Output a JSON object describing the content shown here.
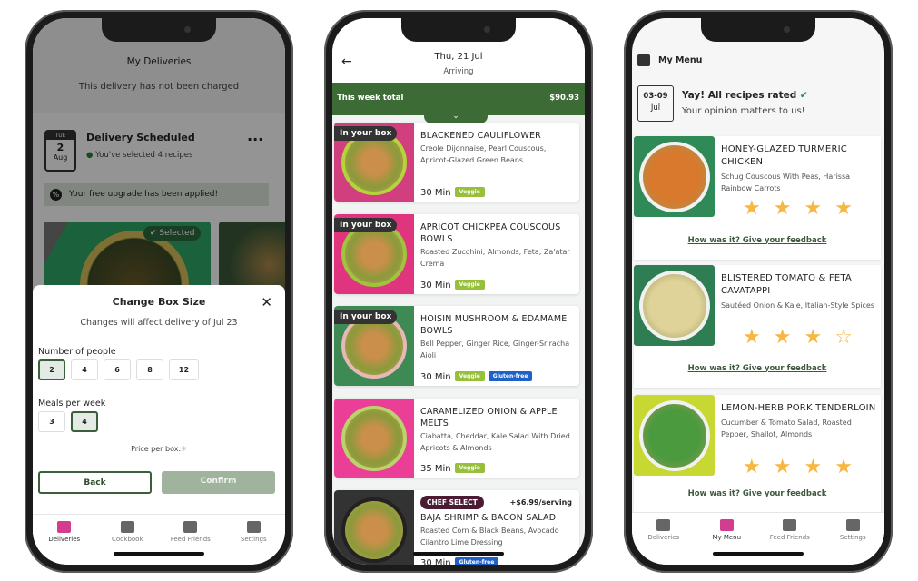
{
  "colors": {
    "brand_green": "#3d6b35",
    "accent_pink": "#d43c8e",
    "veggie": "#96bf3a",
    "gluten_free": "#1e62c9",
    "chef_select": "#4a1b33",
    "star": "#f7b843"
  },
  "deliveries": {
    "title": "My Deliveries",
    "subtitle": "This delivery has not been charged",
    "calendar": {
      "weekday": "TUE",
      "day": "2",
      "month": "Aug"
    },
    "status_title": "Delivery Scheduled",
    "status_text": "You've selected 4 recipes",
    "more_icon": "ellipsis-icon",
    "upgrade_banner": "Your free upgrade has been applied!",
    "selected_badge": "Selected",
    "modal": {
      "title": "Change Box Size",
      "subtitle": "Changes will affect delivery of  Jul 23",
      "people_label": "Number of people",
      "people_options": [
        "2",
        "4",
        "6",
        "8",
        "12"
      ],
      "people_selected": "2",
      "meals_label": "Meals per week",
      "meals_options": [
        "3",
        "4"
      ],
      "meals_selected": "4",
      "price_label": "Price per box:",
      "back": "Back",
      "confirm": "Confirm"
    },
    "nav": [
      "Deliveries",
      "Cookbook",
      "Feed Friends",
      "Settings"
    ],
    "nav_active": "Deliveries"
  },
  "week": {
    "date": "Thu, 21 Jul",
    "status": "Arriving",
    "total_label": "This week total",
    "total": "$90.93",
    "recipes": [
      {
        "badge": "In your box",
        "title": "BLACKENED CAULIFLOWER",
        "desc": "Creole Dijonnaise, Pearl Couscous, Apricot-Glazed Green Beans",
        "time": "30 Min",
        "tags": [
          "Veggie"
        ]
      },
      {
        "badge": "In your box",
        "title": "APRICOT CHICKPEA COUSCOUS BOWLS",
        "desc": "Roasted Zucchini, Almonds, Feta, Za'atar Crema",
        "time": "30 Min",
        "tags": [
          "Veggie"
        ]
      },
      {
        "badge": "In your box",
        "title": "HOISIN MUSHROOM & EDAMAME BOWLS",
        "desc": "Bell Pepper, Ginger Rice, Ginger-Sriracha Aioli",
        "time": "30 Min",
        "tags": [
          "Veggie",
          "Gluten-free"
        ]
      },
      {
        "badge": "",
        "title": "CARAMELIZED ONION & APPLE MELTS",
        "desc": "Ciabatta, Cheddar, Kale Salad With Dried Apricots & Almonds",
        "time": "35 Min",
        "tags": [
          "Veggie"
        ]
      },
      {
        "badge": "",
        "chef": "CHEF SELECT",
        "price": "+$6.99/serving",
        "title": "BAJA SHRIMP & BACON SALAD",
        "desc": "Roasted Corn & Black Beans, Avocado Cilantro Lime Dressing",
        "time": "30 Min",
        "tags": [
          "Gluten-free"
        ]
      }
    ]
  },
  "menu": {
    "title": "My Menu",
    "date_range": "03-09",
    "date_month": "Jul",
    "rated_title": "Yay! All recipes rated",
    "rated_sub": "Your opinion matters to us!",
    "feedback_link": "How was it? Give your feedback",
    "recipes": [
      {
        "title": "HONEY-GLAZED TURMERIC CHICKEN",
        "desc": "Schug Couscous With Peas, Harissa Rainbow Carrots",
        "rating": 4,
        "max": 4
      },
      {
        "title": "BLISTERED TOMATO & FETA CAVATAPPI",
        "desc": "Sautéed Onion & Kale, Italian-Style Spices",
        "rating": 3,
        "max": 4
      },
      {
        "title": "LEMON-HERB PORK TENDERLOIN",
        "desc": "Cucumber & Tomato Salad, Roasted Pepper, Shallot, Almonds",
        "rating": 4,
        "max": 4
      }
    ],
    "nav": [
      "Deliveries",
      "My Menu",
      "Feed Friends",
      "Settings"
    ],
    "nav_active": "My Menu"
  }
}
